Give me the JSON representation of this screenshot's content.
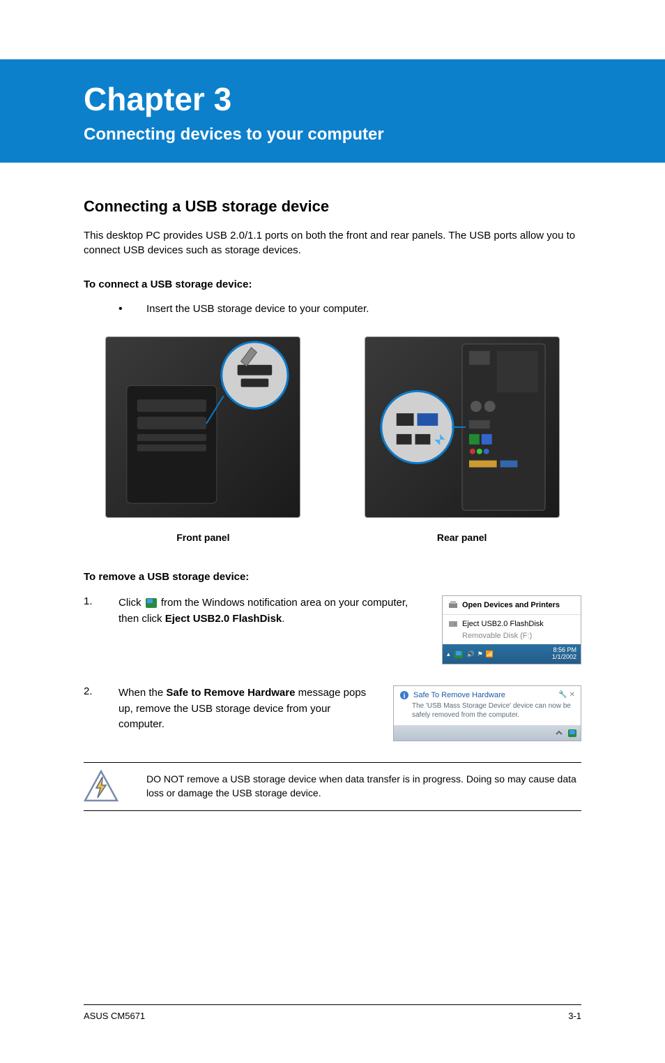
{
  "header": {
    "chapter_title": "Chapter 3",
    "chapter_subtitle": "Connecting devices to your computer"
  },
  "section": {
    "heading": "Connecting a USB storage device",
    "intro": "This desktop PC provides USB 2.0/1.1 ports on both the front and rear panels. The USB ports allow you to connect USB devices such as storage devices.",
    "connect_heading": "To connect a USB storage device:",
    "connect_bullet": "Insert the USB storage device to your computer.",
    "panels": {
      "front_caption": "Front panel",
      "rear_caption": "Rear panel"
    },
    "remove_heading": "To remove a USB storage device:",
    "steps": [
      {
        "num": "1.",
        "before_icon": "Click ",
        "after_icon": " from the Windows notification area on your computer, then click ",
        "bold1": "Eject USB2.0 FlashDisk",
        "after_bold": "."
      },
      {
        "num": "2.",
        "before_bold": "When the ",
        "bold1": "Safe to Remove Hardware",
        "after_bold": " message pops up, remove the USB storage device from your computer."
      }
    ],
    "eject_menu": {
      "open_devices": "Open Devices and Printers",
      "eject_item": "Eject USB2.0 FlashDisk",
      "removable": "Removable Disk (F:)",
      "time": "8:56 PM",
      "date": "1/1/2002"
    },
    "safe_remove": {
      "title": "Safe To Remove Hardware",
      "body": "The 'USB Mass Storage Device' device can now be safely removed from the computer."
    },
    "warning": "DO NOT remove a USB storage device when data transfer is in progress. Doing so may cause data loss or damage the USB storage device."
  },
  "footer": {
    "left": "ASUS CM5671",
    "right": "3-1"
  }
}
